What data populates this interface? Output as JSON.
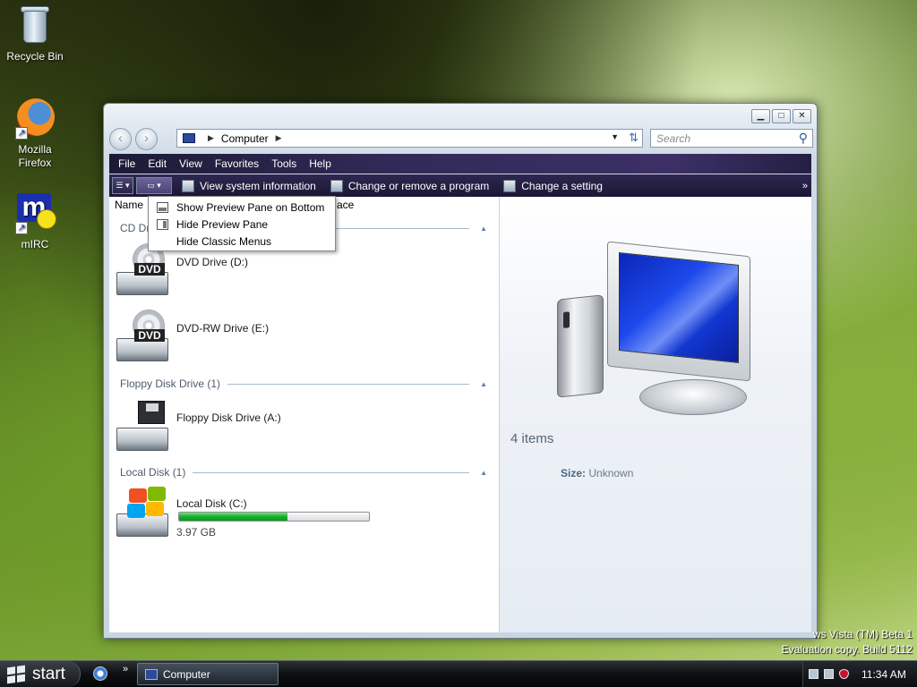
{
  "desktop": {
    "icons": [
      {
        "label": "Recycle Bin",
        "icon": "recycle-bin-icon"
      },
      {
        "label": "Mozilla Firefox",
        "icon": "firefox-icon"
      },
      {
        "label": "mIRC",
        "icon": "mirc-icon"
      }
    ],
    "watermark": {
      "line1": "ws Vista (TM) Beta 1",
      "line2": "Evaluation copy. Build 5112"
    }
  },
  "window": {
    "address": {
      "root_icon": "computer-icon",
      "segment": "Computer"
    },
    "search_placeholder": "Search",
    "menu": [
      "File",
      "Edit",
      "View",
      "Favorites",
      "Tools",
      "Help"
    ],
    "commands": [
      {
        "label": "View system information",
        "icon": "system-info-icon"
      },
      {
        "label": "Change or remove a program",
        "icon": "programs-icon"
      },
      {
        "label": "Change a setting",
        "icon": "settings-icon"
      }
    ],
    "columns": {
      "name": "Name",
      "partial": "ace"
    },
    "groups": {
      "cd": "CD Dri",
      "floppy": "Floppy Disk Drive (1)",
      "local": "Local Disk (1)"
    },
    "drives": {
      "dvd": {
        "name": "DVD Drive (D:)",
        "badge": "DVD"
      },
      "dvdrw": {
        "name": "DVD-RW Drive (E:)",
        "badge": "DVD"
      },
      "floppy": {
        "name": "Floppy Disk Drive (A:)"
      },
      "local": {
        "name": "Local Disk (C:)",
        "free": "3.97 GB",
        "used_fraction": 0.57
      }
    },
    "preview": {
      "items": "4 items",
      "size_label": "Size:",
      "size_value": "Unknown"
    },
    "popup": [
      {
        "label": "Show Preview Pane on Bottom",
        "icon": "preview-bottom-icon"
      },
      {
        "label": "Hide Preview Pane",
        "icon": "preview-right-icon"
      },
      {
        "label": "Hide Classic Menus",
        "icon": ""
      }
    ]
  },
  "taskbar": {
    "start_label": "start",
    "task_label": "Computer",
    "clock": "11:34 AM"
  }
}
